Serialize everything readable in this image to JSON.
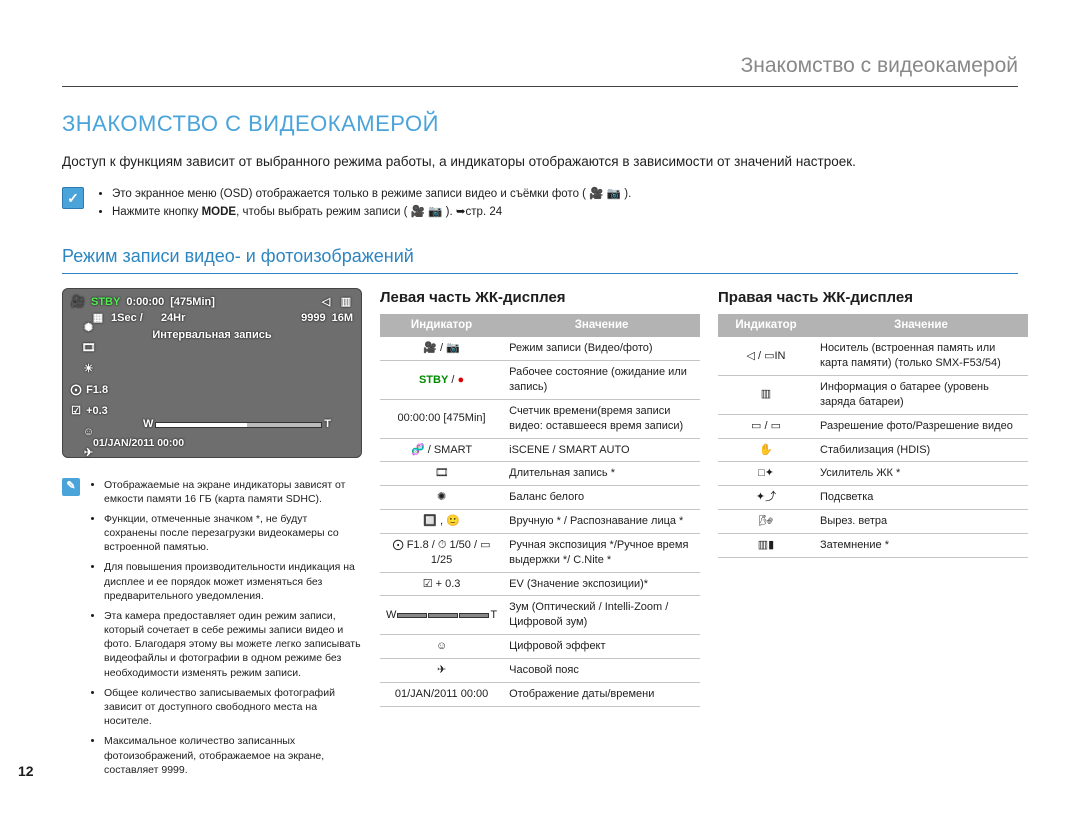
{
  "page_number": "12",
  "breadcrumb": "Знакомство с видеокамерой",
  "heading": "ЗНАКОМСТВО С ВИДЕОКАМЕРОЙ",
  "intro": "Доступ к функциям зависит от выбранного режима работы, а индикаторы отображаются в зависимости от значений настроек.",
  "top_notes": {
    "n1": "Это экранное меню (OSD) отображается только в режиме записи видео и съёмки фото (",
    "n1_tail": " ).",
    "n2_a": "Нажмите кнопку ",
    "n2_mode": "MODE",
    "n2_b": ", чтобы выбрать режим записи (",
    "n2_c": " ). ",
    "n2_link": "➥стр. 24"
  },
  "subsection": "Режим записи видео- и фотоизображений",
  "lcd": {
    "stby": "STBY",
    "timer": "0:00:00",
    "remain": "[475Min]",
    "sec": "1Sec /",
    "hr": "24Hr",
    "count": "9999",
    "res": "16M",
    "interval": "Интервальная запись",
    "f": "F1.8",
    "ev": "+0.3",
    "zoom_w": "W",
    "zoom_t": "T",
    "date": "01/JAN/2011 00:00",
    "card": "◁",
    "batt": "▯▯▯"
  },
  "side_notes": [
    "Отображаемые на экране индикаторы зависят от емкости памяти 16 ГБ (карта памяти SDHC).",
    "Функции, отмеченные значком *, не будут сохранены после перезагрузки видеокамеры со встроенной памятью.",
    "Для повышения производительности индикация на дисплее и ее порядок может изменяться без предварительного уведомления.",
    "Эта камера предоставляет один режим записи, который сочетает в себе режимы записи видео и фото. Благодаря этому вы можете легко записывать видеофайлы и фотографии в одном режиме без необходимости изменять режим записи.",
    "Общее количество записываемых фотографий зависит от доступного свободного места на носителе.",
    "Максимальное количество записанных фотоизображений, отображаемое на экране, составляет 9999."
  ],
  "left_panel_title": "Левая часть ЖК-дисплея",
  "right_panel_title": "Правая часть ЖК-дисплея",
  "th_indicator": "Индикатор",
  "th_meaning": "Значение",
  "left_rows": [
    {
      "icon": "🎥 / 📷",
      "meaning": "Режим записи (Видео/фото)"
    },
    {
      "icon": "STBY / ●",
      "meaning": "Рабочее состояние (ожидание или запись)",
      "stby": true
    },
    {
      "icon": "00:00:00 [475Min]",
      "meaning": "Счетчик времени(время записи видео: оставшееся время записи)"
    },
    {
      "icon": "🧬 / SMART",
      "meaning": "iSCENE / SMART AUTO"
    },
    {
      "icon": "🎞",
      "meaning": "Длительная запись *"
    },
    {
      "icon": "✺",
      "meaning": "Баланс белого"
    },
    {
      "icon": "🔲 , 🙂",
      "meaning": "Вручную * / Распознавание лица *"
    },
    {
      "icon": "⨀ F1.8 /  ⏱ 1/50 /  ▭ 1/25",
      "meaning": "Ручная экспозиция */Ручное время выдержки */ C.Nite *"
    },
    {
      "icon": "☑ + 0.3",
      "meaning": "EV (Значение экспозиции)*"
    },
    {
      "icon": "ZOOM",
      "meaning": "Зум (Оптический / Intelli-Zoom /Цифровой зум)"
    },
    {
      "icon": "☺",
      "meaning": "Цифровой эффект"
    },
    {
      "icon": "✈",
      "meaning": "Часовой пояс"
    },
    {
      "icon": "01/JAN/2011 00:00",
      "meaning": "Отображение даты/времени"
    }
  ],
  "right_rows": [
    {
      "icon": "◁ / ▭IN",
      "meaning": "Носитель (встроенная память или карта памяти) (только SMX-F53/54)"
    },
    {
      "icon": "▥",
      "meaning": "Информация о батарее (уровень заряда батареи)"
    },
    {
      "icon": "▭ / ▭",
      "meaning": "Разрешение фото/Разрешение видео"
    },
    {
      "icon": "✋",
      "meaning": "Стабилизация (HDIS)"
    },
    {
      "icon": "□✦",
      "meaning": "Усилитель ЖК *"
    },
    {
      "icon": "✦⤴",
      "meaning": "Подсветка"
    },
    {
      "icon": "🌬",
      "meaning": "Вырез. ветра"
    },
    {
      "icon": "▥▮",
      "meaning": "Затемнение *"
    }
  ]
}
